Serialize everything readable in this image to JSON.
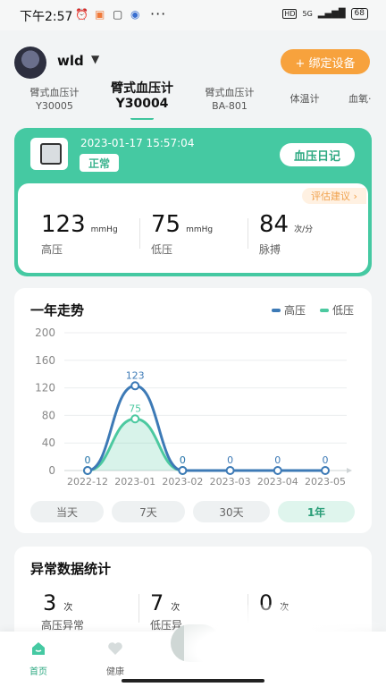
{
  "status_bar": {
    "time": "下午2:57",
    "more": "···",
    "hd": "HD",
    "net": "5G",
    "battery": "68"
  },
  "header": {
    "username": "wld",
    "bind_button": "+ 绑定设备"
  },
  "device_tabs": [
    {
      "name": "臂式血压计",
      "model": "Y30005",
      "active": false
    },
    {
      "name": "臂式血压计",
      "model": "Y30004",
      "active": true
    },
    {
      "name": "臂式血压计",
      "model": "BA-801",
      "active": false
    },
    {
      "name": "体温计",
      "model": "",
      "active": false
    },
    {
      "name": "血氧·",
      "model": "",
      "active": false
    }
  ],
  "measurement": {
    "datetime": "2023-01-17 15:57:04",
    "status": "正常",
    "diary_button": "血压日记",
    "advice_button": "评估建议 ›",
    "values": [
      {
        "value": "123",
        "unit": "mmHg",
        "label": "高压"
      },
      {
        "value": "75",
        "unit": "mmHg",
        "label": "低压"
      },
      {
        "value": "84",
        "unit": "次/分",
        "label": "脉搏"
      }
    ]
  },
  "trend": {
    "title": "一年走势",
    "ranges": [
      {
        "label": "当天",
        "active": false
      },
      {
        "label": "7天",
        "active": false
      },
      {
        "label": "30天",
        "active": false
      },
      {
        "label": "1年",
        "active": true
      }
    ]
  },
  "chart_data": {
    "type": "area",
    "categories": [
      "2022-12",
      "2023-01",
      "2023-02",
      "2023-03",
      "2023-04",
      "2023-05"
    ],
    "series": [
      {
        "name": "高压",
        "color": "#3d7ab6",
        "values": [
          0,
          123,
          0,
          0,
          0,
          0
        ]
      },
      {
        "name": "低压",
        "color": "#4cc9a0",
        "values": [
          0,
          75,
          0,
          null,
          null,
          null
        ]
      }
    ],
    "ylim": [
      0,
      200
    ],
    "yticks": [
      0,
      40,
      80,
      120,
      160,
      200
    ],
    "legend": "top-right",
    "grid": true
  },
  "abnormal": {
    "title": "异常数据统计",
    "items": [
      {
        "value": "3",
        "unit": "次",
        "label": "高压异常"
      },
      {
        "value": "7",
        "unit": "次",
        "label": "低压异"
      },
      {
        "value": "0",
        "unit": "次",
        "label": ""
      }
    ]
  },
  "bottom_nav": {
    "items": [
      {
        "label": "首页",
        "active": true
      },
      {
        "label": "健康",
        "active": false
      }
    ]
  },
  "colors": {
    "accent": "#45c9a2",
    "orange": "#f7a23d",
    "systolic": "#3d7ab6",
    "diastolic": "#4cc9a0"
  }
}
